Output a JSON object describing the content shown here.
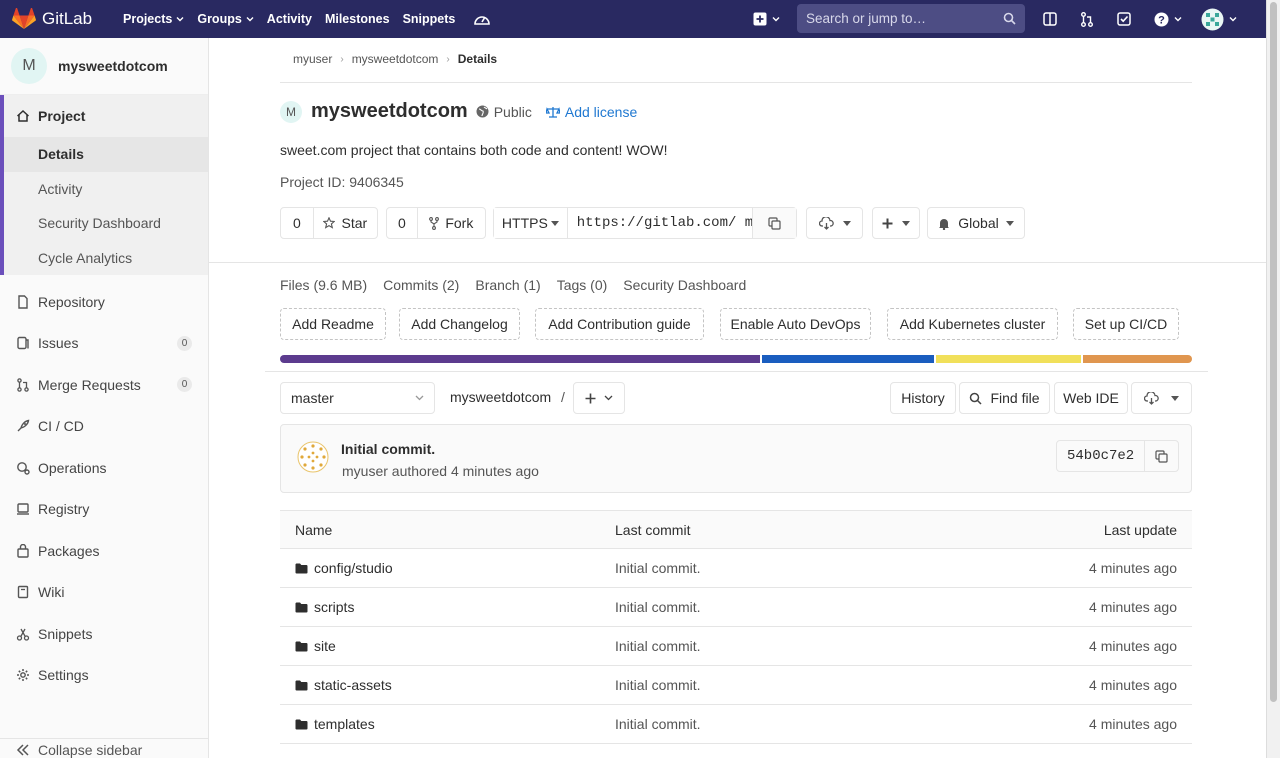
{
  "nav": {
    "brand": "GitLab",
    "links": [
      "Projects",
      "Groups",
      "Activity",
      "Milestones",
      "Snippets"
    ],
    "search_placeholder": "Search or jump to…"
  },
  "sidebar": {
    "avatar_letter": "M",
    "project_name": "mysweetdotcom",
    "project_section": "Project",
    "sub_items": [
      "Details",
      "Activity",
      "Security Dashboard",
      "Cycle Analytics"
    ],
    "items": [
      {
        "label": "Repository",
        "icon": "doc-icon"
      },
      {
        "label": "Issues",
        "icon": "issues-icon",
        "count": "0"
      },
      {
        "label": "Merge Requests",
        "icon": "merge-request-icon",
        "count": "0"
      },
      {
        "label": "CI / CD",
        "icon": "rocket-icon"
      },
      {
        "label": "Operations",
        "icon": "operations-icon"
      },
      {
        "label": "Registry",
        "icon": "registry-icon"
      },
      {
        "label": "Packages",
        "icon": "package-icon"
      },
      {
        "label": "Wiki",
        "icon": "book-icon"
      },
      {
        "label": "Snippets",
        "icon": "snippet-icon"
      },
      {
        "label": "Settings",
        "icon": "settings-icon"
      }
    ],
    "collapse": "Collapse sidebar"
  },
  "breadcrumb": [
    "myuser",
    "mysweetdotcom",
    "Details"
  ],
  "project": {
    "avatar_letter": "M",
    "title": "mysweetdotcom",
    "visibility": "Public",
    "add_license": "Add license",
    "description": "sweet.com project that contains both code and content! WOW!",
    "project_id": "Project ID: 9406345"
  },
  "actions": {
    "star_count": "0",
    "star": "Star",
    "fork_count": "0",
    "fork": "Fork",
    "protocol": "HTTPS",
    "clone_url": "https://gitlab.com/ my",
    "notification": "Global"
  },
  "stats": [
    "Files (9.6 MB)",
    "Commits (2)",
    "Branch (1)",
    "Tags (0)",
    "Security Dashboard"
  ],
  "quick_buttons": [
    "Add Readme",
    "Add Changelog",
    "Add Contribution guide",
    "Enable Auto DevOps",
    "Add Kubernetes cluster",
    "Set up CI/CD"
  ],
  "languages": [
    {
      "color": "#5c3b8e",
      "share": 53
    },
    {
      "color": "#1a5dbf",
      "share": 19
    },
    {
      "color": "#f1e05a",
      "share": 16
    },
    {
      "color": "#e0964f",
      "share": 12
    }
  ],
  "repo_bar": {
    "branch": "master",
    "path": "mysweetdotcom",
    "path_sep": "/",
    "history": "History",
    "find_file": "Find file",
    "web_ide": "Web IDE"
  },
  "commit": {
    "title": "Initial commit.",
    "meta": "myuser authored 4 minutes ago",
    "sha": "54b0c7e2"
  },
  "files": {
    "headers": [
      "Name",
      "Last commit",
      "Last update"
    ],
    "rows": [
      {
        "name": "config/studio",
        "commit": "Initial commit.",
        "updated": "4 minutes ago"
      },
      {
        "name": "scripts",
        "commit": "Initial commit.",
        "updated": "4 minutes ago"
      },
      {
        "name": "site",
        "commit": "Initial commit.",
        "updated": "4 minutes ago"
      },
      {
        "name": "static-assets",
        "commit": "Initial commit.",
        "updated": "4 minutes ago"
      },
      {
        "name": "templates",
        "commit": "Initial commit.",
        "updated": "4 minutes ago"
      }
    ]
  }
}
